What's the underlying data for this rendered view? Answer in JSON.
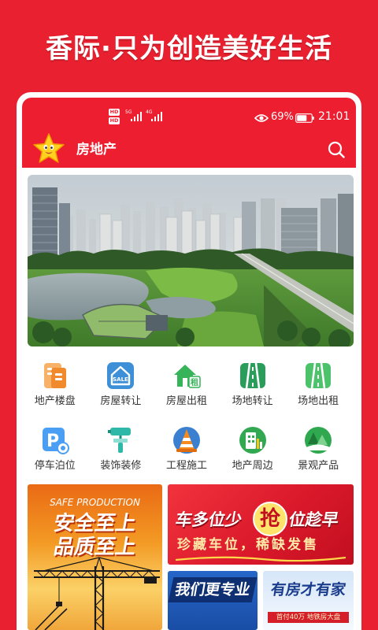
{
  "slogan": "香际·只为创造美好生活",
  "status_bar": {
    "hd_badges": [
      "HD",
      "HD"
    ],
    "network_labels": [
      "5G",
      "4G"
    ],
    "battery_percent": "69%",
    "battery_level": 0.69,
    "time": "21:01",
    "icons": [
      "signal-icon",
      "eye-icon",
      "battery-icon"
    ]
  },
  "app_bar": {
    "title": "房地产",
    "logo_icon": "star-mascot-icon",
    "search_icon": "search-icon"
  },
  "categories": [
    {
      "label": "地产楼盘",
      "icon": "building-doc-icon"
    },
    {
      "label": "房屋转让",
      "icon": "house-sale-icon",
      "icon_text": "SALE"
    },
    {
      "label": "房屋出租",
      "icon": "house-rent-icon",
      "icon_text": "租"
    },
    {
      "label": "场地转让",
      "icon": "field-transfer-icon"
    },
    {
      "label": "场地出租",
      "icon": "field-rent-icon"
    },
    {
      "label": "停车泊位",
      "icon": "parking-icon",
      "icon_text": "P"
    },
    {
      "label": "装饰装修",
      "icon": "paint-roller-icon"
    },
    {
      "label": "工程施工",
      "icon": "traffic-cone-icon"
    },
    {
      "label": "地产周边",
      "icon": "building-chart-icon"
    },
    {
      "label": "景观产品",
      "icon": "trees-icon"
    }
  ],
  "promos": {
    "safety": {
      "eyebrow": "SAFE PRODUCTION",
      "line1": "安全至上",
      "line2": "品质至上"
    },
    "parking": {
      "headline_left": "车多位少",
      "highlight": "抢",
      "headline_right": "位趁早",
      "subtitle": "珍藏车位，稀缺发售"
    },
    "pro": {
      "text": "我们更专业"
    },
    "home": {
      "title": "有房才有家",
      "subtitle": "首付40万 地铁房大盘"
    }
  },
  "colors": {
    "brand_red": "#e8202f",
    "header_red": "#ee1e31",
    "text_dark": "#333333",
    "promo_blue": "#1a4ea6",
    "promo_orange": "#f39a24"
  }
}
